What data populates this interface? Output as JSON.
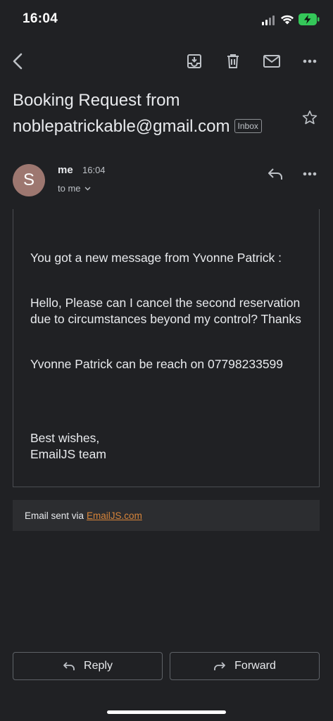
{
  "status_bar": {
    "time": "16:04"
  },
  "subject": {
    "line1": "Booking Request from",
    "line2": "noblepatrickable@gmail.com",
    "label": "Inbox"
  },
  "sender": {
    "avatar_letter": "S",
    "name": "me",
    "time": "16:04",
    "recipient": "to me"
  },
  "message": {
    "intro": "You got a new message from Yvonne Patrick :",
    "body": "Hello, Please can I cancel the second reservation due to circumstances beyond my control? Thanks",
    "contact": "Yvonne Patrick can be reach on 07798233599",
    "signoff_line1": "Best wishes,",
    "signoff_line2": "EmailJS team"
  },
  "footer": {
    "prefix": "Email sent via",
    "link_text": "EmailJS.com"
  },
  "actions": {
    "reply_label": "Reply",
    "forward_label": "Forward"
  },
  "colors": {
    "background": "#202124",
    "link": "#d8853a",
    "battery": "#34c759",
    "avatar": "#9d7770"
  },
  "icons": [
    "back-arrow-icon",
    "archive-icon",
    "trash-icon",
    "mail-icon",
    "more-icon",
    "star-icon",
    "reply-icon",
    "chevron-down-icon",
    "forward-icon"
  ]
}
